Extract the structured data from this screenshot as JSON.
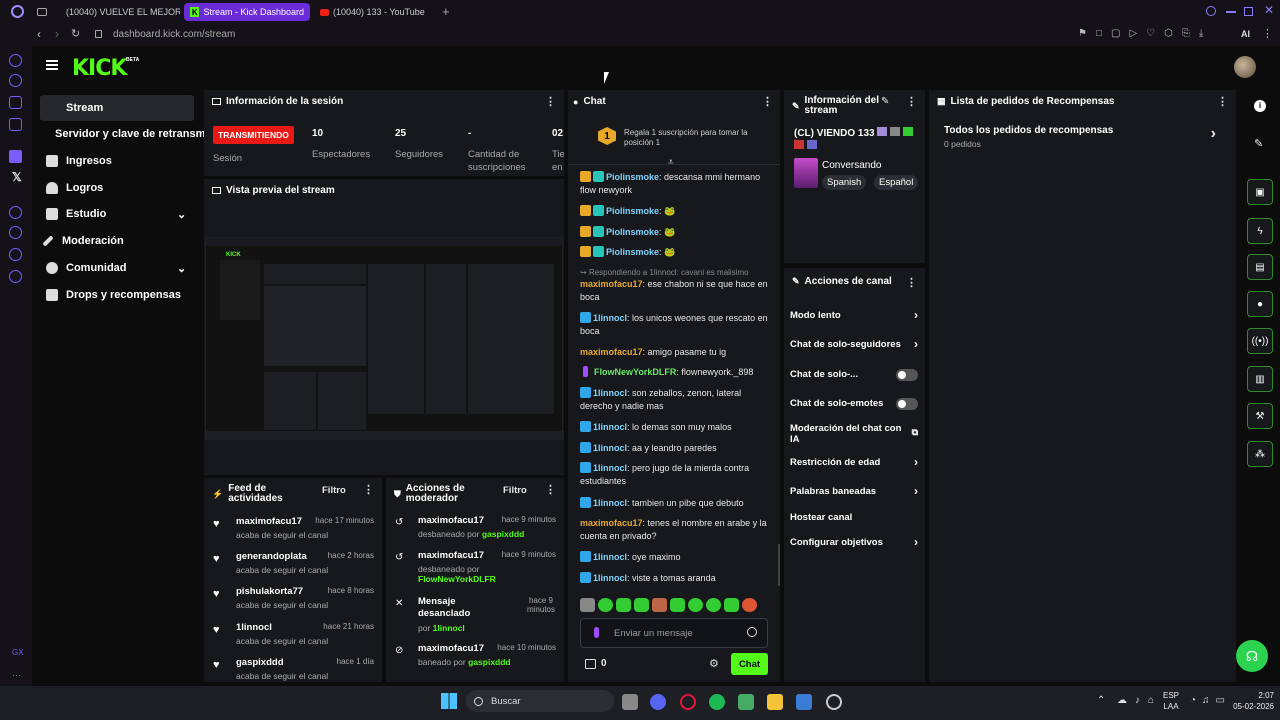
{
  "browser": {
    "tabs": [
      {
        "label": "(10040) VUELVE EL MEJOR..."
      },
      {
        "label": "Stream - Kick Dashboard"
      },
      {
        "label": "(10040) 133 - YouTube"
      }
    ],
    "url": "dashboard.kick.com/stream",
    "ai_label": "AI"
  },
  "header": {
    "logo": "KICK",
    "beta": "BETA"
  },
  "nav": {
    "items": [
      {
        "label": "Stream"
      },
      {
        "label": "Servidor y clave de retransmisión"
      },
      {
        "label": "Ingresos"
      },
      {
        "label": "Logros"
      },
      {
        "label": "Estudio"
      },
      {
        "label": "Moderación"
      },
      {
        "label": "Comunidad"
      },
      {
        "label": "Drops y recompensas"
      }
    ]
  },
  "session": {
    "title": "Información de la sesión",
    "status": "TRANSMITIENDO",
    "status_label": "Sesión",
    "stats": [
      {
        "value": "10",
        "label": "Espectadores"
      },
      {
        "value": "25",
        "label": "Seguidores"
      },
      {
        "value": "-",
        "label": "Cantidad de suscripciones"
      },
      {
        "value": "02",
        "label": "Tie en"
      }
    ]
  },
  "preview": {
    "title": "Vista previa del stream"
  },
  "activity": {
    "title": "Feed de actividades",
    "filter": "Filtro",
    "items": [
      {
        "user": "maximofacu17",
        "time": "hace 17 minutos",
        "text": "acaba de seguir el canal"
      },
      {
        "user": "generandoplata",
        "time": "hace 2 horas",
        "text": "acaba de seguir el canal"
      },
      {
        "user": "pishulakorta77",
        "time": "hace 8 horas",
        "text": "acaba de seguir el canal"
      },
      {
        "user": "1linnocl",
        "time": "hace 21 horas",
        "text": "acaba de seguir el canal"
      },
      {
        "user": "gaspixddd",
        "time": "hace 1 día",
        "text": "acaba de seguir el canal"
      }
    ]
  },
  "modactions": {
    "title": "Acciones de moderador",
    "filter": "Filtro",
    "items": [
      {
        "user": "maximofacu17",
        "time": "hace 9 minutos",
        "text": "desbaneado por",
        "by": "gaspixddd"
      },
      {
        "user": "maximofacu17",
        "time": "hace 9 minutos",
        "text": "desbaneado por",
        "by": "FlowNewYorkDLFR"
      },
      {
        "user": "Mensaje desanclado",
        "time": "hace 9 minutos",
        "text": "por",
        "by": "1linnocl"
      },
      {
        "user": "maximofacu17",
        "time": "hace 10 minutos",
        "text": "baneado por",
        "by": "gaspixddd"
      }
    ]
  },
  "chat": {
    "title": "Chat",
    "sub_prompt": "Regala 1 suscripción para tomar la posición 1",
    "sub_rank": "1",
    "reply_to": "Respondiendo a 1linnocl: cavani es malisimo",
    "messages": [
      {
        "user": "Piolinsmoke",
        "color": "#7fd4ff",
        "text": " descansa mmi hermano flow newyork"
      },
      {
        "user": "Piolinsmoke",
        "color": "#7fd4ff",
        "text": " 🐸"
      },
      {
        "user": "Piolinsmoke",
        "color": "#7fd4ff",
        "text": " 🐸"
      },
      {
        "user": "Piolinsmoke",
        "color": "#7fd4ff",
        "text": " 🐸"
      },
      {
        "user": "maximofacu17",
        "color": "#e8a92a",
        "text": " ese chabon ni se que hace en boca"
      },
      {
        "user": "1linnocl",
        "color": "#7fd4ff",
        "text": " los unicos weones que rescato en boca"
      },
      {
        "user": "maximofacu17",
        "color": "#e8a92a",
        "text": " amigo pasame tu ig"
      },
      {
        "user": "FlowNewYorkDLFR",
        "color": "#6ae86a",
        "text": " flownewyork._898"
      },
      {
        "user": "1linnocl",
        "color": "#7fd4ff",
        "text": " son zeballos, zenon, lateral derecho y nadie mas"
      },
      {
        "user": "1linnocl",
        "color": "#7fd4ff",
        "text": " lo demas son muy malos"
      },
      {
        "user": "1linnocl",
        "color": "#7fd4ff",
        "text": " aa y leandro paredes"
      },
      {
        "user": "1linnocl",
        "color": "#7fd4ff",
        "text": " pero jugo de la mierda contra estudiantes"
      },
      {
        "user": "1linnocl",
        "color": "#7fd4ff",
        "text": " tambien un pibe que debuto"
      },
      {
        "user": "maximofacu17",
        "color": "#e8a92a",
        "text": " tenes el nombre en arabe y la cuenta en privado?"
      },
      {
        "user": "1linnocl",
        "color": "#7fd4ff",
        "text": " oye maximo"
      },
      {
        "user": "1linnocl",
        "color": "#7fd4ff",
        "text": " viste a tomas aranda"
      }
    ],
    "input_placeholder": "Enviar un mensaje",
    "count": "0",
    "send_label": "Chat"
  },
  "streaminfo": {
    "title": "Información del stream",
    "name": "(CL) VIENDO 133",
    "category": "Conversando",
    "tags": [
      "Spanish",
      "Español"
    ]
  },
  "channel": {
    "title": "Acciones de canal",
    "items": [
      {
        "label": "Modo lento",
        "control": "chevron"
      },
      {
        "label": "Chat de solo-seguidores",
        "control": "chevron"
      },
      {
        "label": "Chat de solo-...",
        "control": "toggle"
      },
      {
        "label": "Chat de solo-emotes",
        "control": "toggle"
      },
      {
        "label": "Moderación del chat con IA",
        "control": "external"
      },
      {
        "label": "Restricción de edad",
        "control": "chevron"
      },
      {
        "label": "Palabras baneadas",
        "control": "chevron"
      },
      {
        "label": "Hostear canal",
        "control": "none"
      },
      {
        "label": "Configurar objetivos",
        "control": "chevron"
      }
    ]
  },
  "rewards": {
    "title": "Lista de pedidos de Recompensas",
    "all_label": "Todos los pedidos de recompensas",
    "count_label": "0 pedidos"
  },
  "taskbar": {
    "search": "Buscar",
    "lang1": "ESP",
    "lang2": "LAA",
    "time": "2:07",
    "date": "05-02-2026"
  },
  "colors": {
    "accent": "#53fc18",
    "live": "#e91916",
    "panel": "#16181c"
  }
}
